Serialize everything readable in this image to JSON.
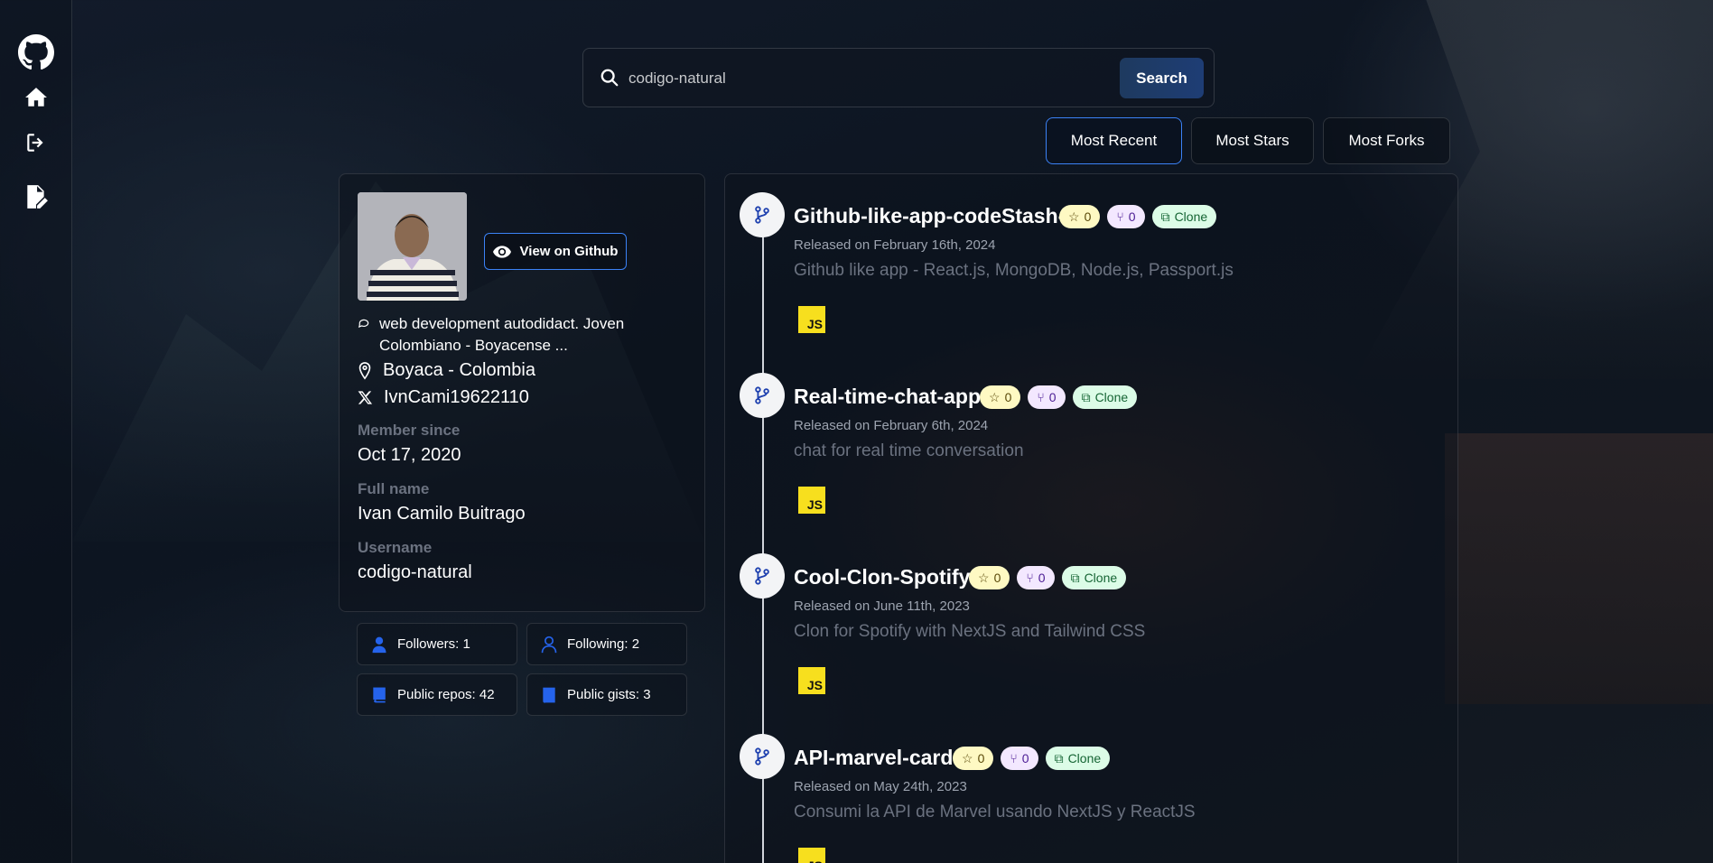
{
  "sidebar": {
    "items": [
      {
        "icon": "github-icon"
      },
      {
        "icon": "home-icon"
      },
      {
        "icon": "login-icon"
      },
      {
        "icon": "signup-icon"
      }
    ]
  },
  "search": {
    "value": "codigo-natural",
    "button_label": "Search"
  },
  "sort": {
    "options": [
      "Most Recent",
      "Most Stars",
      "Most Forks"
    ],
    "active": "Most Recent"
  },
  "profile": {
    "view_button_label": "View on Github",
    "bio": "web development autodidact. Joven Colombiano - Boyacense ...",
    "location": "Boyaca - Colombia",
    "twitter": "IvnCami19622110",
    "member_since_label": "Member since",
    "member_since": "Oct 17, 2020",
    "full_name_label": "Full name",
    "full_name": "Ivan Camilo Buitrago",
    "username_label": "Username",
    "username": "codigo-natural"
  },
  "stats": {
    "followers": "Followers: 1",
    "following": "Following: 2",
    "public_repos": "Public repos: 42",
    "public_gists": "Public gists: 3"
  },
  "repos": [
    {
      "name": "Github-like-app-codeStash-",
      "stars": "0",
      "forks": "0",
      "clone_label": "Clone",
      "released": "Released on February 16th, 2024",
      "description": "Github like app - React.js, MongoDB, Node.js, Passport.js",
      "language": "JS"
    },
    {
      "name": "Real-time-chat-app",
      "stars": "0",
      "forks": "0",
      "clone_label": "Clone",
      "released": "Released on February 6th, 2024",
      "description": "chat for real time conversation",
      "language": "JS"
    },
    {
      "name": "Cool-Clon-Spotify",
      "stars": "0",
      "forks": "0",
      "clone_label": "Clone",
      "released": "Released on June 11th, 2023",
      "description": "Clon for Spotify with NextJS and Tailwind CSS",
      "language": "JS"
    },
    {
      "name": "API-marvel-card",
      "stars": "0",
      "forks": "0",
      "clone_label": "Clone",
      "released": "Released on May 24th, 2023",
      "description": "Consumi la API de Marvel usando NextJS y ReactJS",
      "language": "JS"
    }
  ],
  "colors": {
    "accent": "#3b82f6",
    "search_button": "#1e3a5f",
    "star_badge": "#fef9c3",
    "fork_badge": "#f3e8ff",
    "clone_badge": "#dcfce7",
    "js_badge": "#f7df1e"
  }
}
